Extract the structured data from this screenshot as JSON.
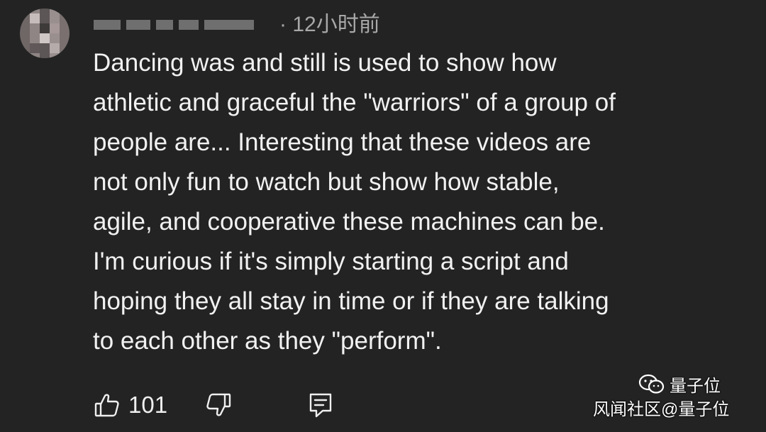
{
  "comment": {
    "timestamp": "· 12小时前",
    "text_lines": [
      "Dancing was and still is used to show how",
      "athletic and graceful the \"warriors\" of a group of",
      "people are... Interesting that these videos are",
      "not only fun to watch but show how stable,",
      "agile, and cooperative these machines can be.",
      "I'm curious if it's simply starting a script and",
      "hoping they all stay in time or if they are talking",
      "to each other as they \"perform\"."
    ]
  },
  "actions": {
    "like_count": "101",
    "like_icon": "thumbs-up-icon",
    "dislike_icon": "thumbs-down-icon",
    "reply_icon": "reply-icon"
  },
  "watermark": {
    "brand": "量子位",
    "source": "风闻社区@量子位",
    "logo_icon": "wechat-icon"
  },
  "colors": {
    "background": "#232323",
    "text": "#f1f1f1",
    "muted": "#a8a8a8"
  }
}
